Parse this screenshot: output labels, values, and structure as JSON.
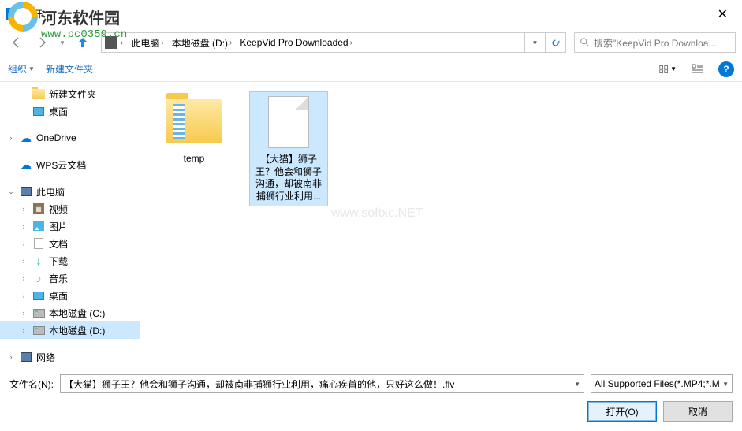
{
  "watermark": {
    "brand": "河东软件园",
    "url": "www.pc0359.cn",
    "center": "www.softxc.NET"
  },
  "titlebar": {
    "title": "打开"
  },
  "breadcrumb": {
    "seg1": "此电脑",
    "seg2": "本地磁盘 (D:)",
    "seg3": "KeepVid Pro Downloaded"
  },
  "search": {
    "placeholder": "搜索\"KeepVid Pro Downloa..."
  },
  "toolbar": {
    "organize": "组织",
    "newfolder": "新建文件夹"
  },
  "sidebar": {
    "items": [
      {
        "label": "新建文件夹"
      },
      {
        "label": "桌面"
      },
      {
        "label": "OneDrive"
      },
      {
        "label": "WPS云文档"
      },
      {
        "label": "此电脑"
      },
      {
        "label": "视频"
      },
      {
        "label": "图片"
      },
      {
        "label": "文档"
      },
      {
        "label": "下载"
      },
      {
        "label": "音乐"
      },
      {
        "label": "桌面"
      },
      {
        "label": "本地磁盘 (C:)"
      },
      {
        "label": "本地磁盘 (D:)"
      },
      {
        "label": "网络"
      }
    ]
  },
  "files": {
    "temp": "temp",
    "video": "【大猫】狮子王？他会和狮子沟通，却被南非捕狮行业利用..."
  },
  "bottom": {
    "filename_label": "文件名(N):",
    "filename_value": "【大猫】狮子王？他会和狮子沟通，却被南非捕狮行业利用，痛心疾首的他，只好这么做！.flv",
    "filter": "All Supported Files(*.MP4;*.M",
    "open": "打开(O)",
    "cancel": "取消"
  }
}
